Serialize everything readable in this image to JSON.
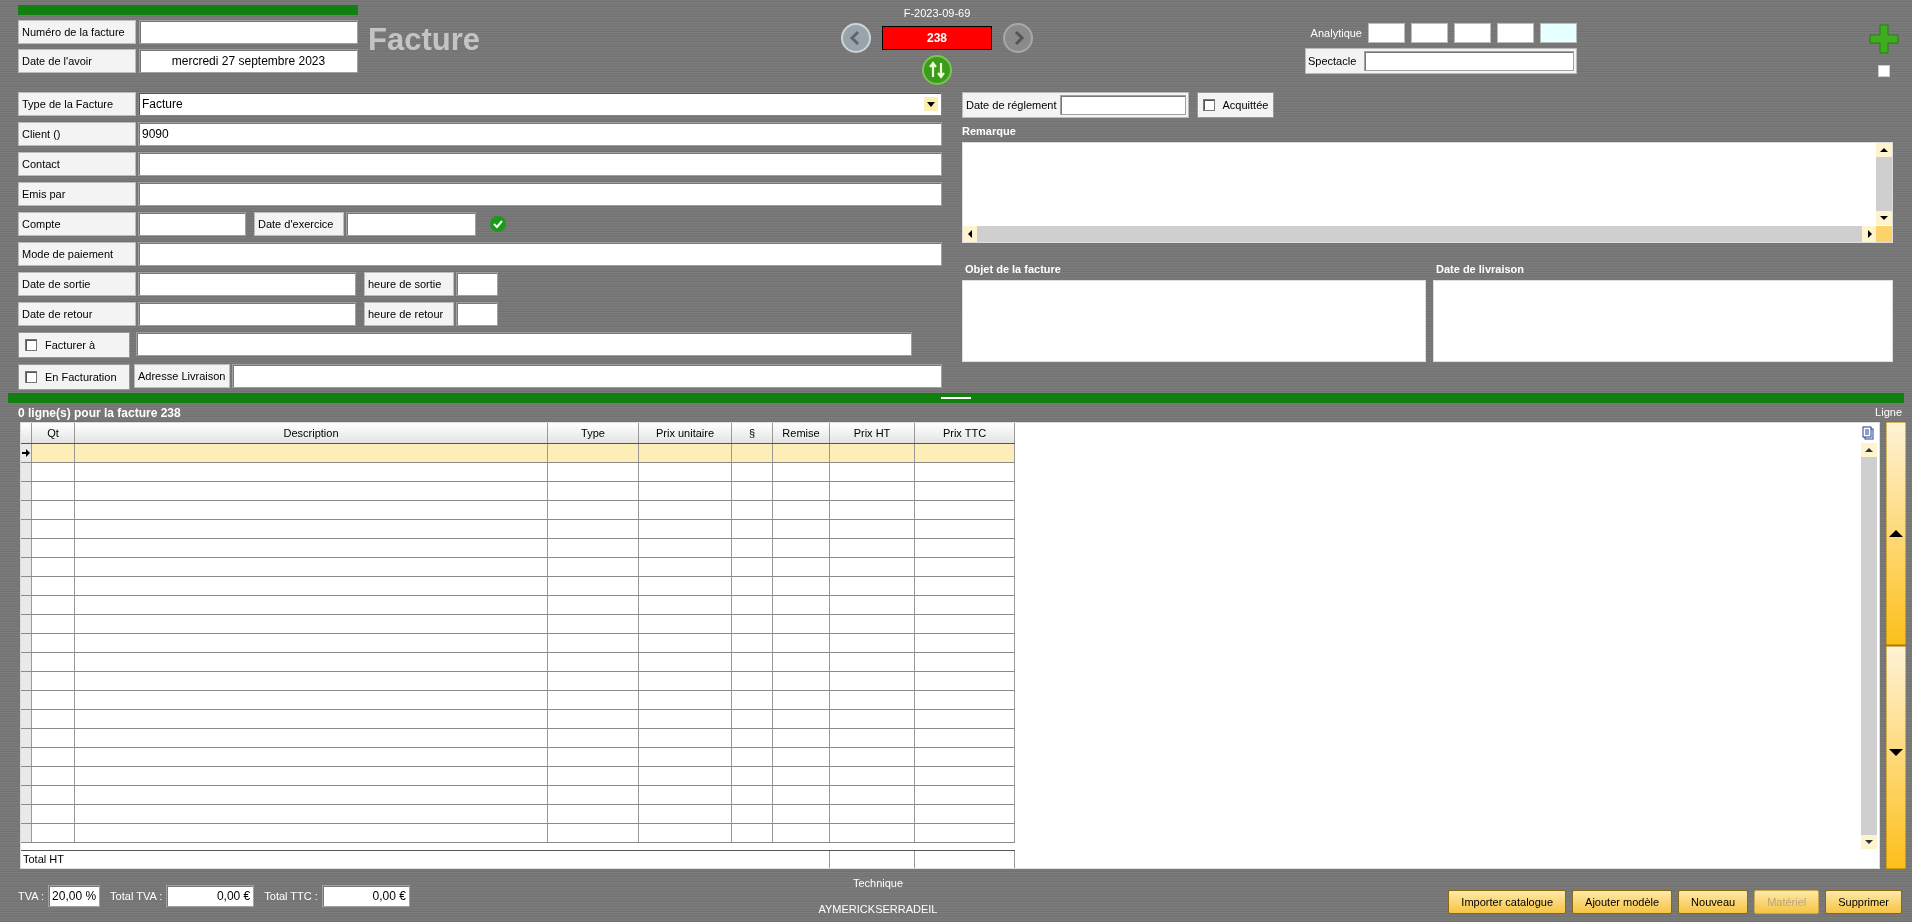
{
  "header": {
    "invoice_number": {
      "label": "Numéro de la facture"
    },
    "credit_date": {
      "label": "Date de l'avoir",
      "value": "mercredi 27 septembre 2023"
    },
    "title": "Facture"
  },
  "navigator": {
    "reference": "F-2023-09-69",
    "number": "238"
  },
  "analytique": {
    "label": "Analytique",
    "fields": [
      {
        "highlighted": false
      },
      {
        "highlighted": false
      },
      {
        "highlighted": false
      },
      {
        "highlighted": false
      },
      {
        "highlighted": true
      }
    ]
  },
  "spectacle": {
    "label": "Spectacle"
  },
  "corner_checkbox": {
    "checked": false
  },
  "form": {
    "type": {
      "label": "Type de la Facture",
      "value": "Facture"
    },
    "client": {
      "label": "Client ()",
      "value": "9090"
    },
    "contact": {
      "label": "Contact"
    },
    "emis_par": {
      "label": "Emis par"
    },
    "compte": {
      "label": "Compte"
    },
    "date_exercice": {
      "label": "Date d'exercice"
    },
    "mode_paiement": {
      "label": "Mode de paiement"
    },
    "date_sortie": {
      "label": "Date de sortie"
    },
    "heure_sortie": {
      "label": "heure de sortie"
    },
    "date_retour": {
      "label": "Date de retour"
    },
    "heure_retour": {
      "label": "heure de retour"
    },
    "facturer_a": {
      "label": "Facturer à",
      "checked": false
    },
    "en_facturation": {
      "label": "En Facturation",
      "checked": false
    },
    "adresse_livraison": {
      "label": "Adresse Livraison"
    }
  },
  "side": {
    "date_reglement": {
      "label": "Date de réglement"
    },
    "acquittee": {
      "label": "Acquittée",
      "checked": false
    },
    "remarque": {
      "label": "Remarque"
    },
    "objet": {
      "label": "Objet de la facture"
    },
    "date_livraison": {
      "label": "Date de livraison"
    }
  },
  "lines": {
    "summary": "0 ligne(s) pour la facture 238",
    "side_label": "Ligne",
    "columns": [
      "Qt",
      "Description",
      "Type",
      "Prix unitaire",
      "§",
      "Remise",
      "Prix HT",
      "Prix TTC"
    ],
    "rows": [
      {
        "selected": true
      },
      {
        "selected": false
      },
      {
        "selected": false
      },
      {
        "selected": false
      },
      {
        "selected": false
      },
      {
        "selected": false
      },
      {
        "selected": false
      },
      {
        "selected": false
      },
      {
        "selected": false
      },
      {
        "selected": false
      },
      {
        "selected": false
      },
      {
        "selected": false
      },
      {
        "selected": false
      },
      {
        "selected": false
      },
      {
        "selected": false
      },
      {
        "selected": false
      },
      {
        "selected": false
      },
      {
        "selected": false
      },
      {
        "selected": false
      },
      {
        "selected": false
      },
      {
        "selected": false
      }
    ],
    "total_label": "Total HT"
  },
  "footer": {
    "tva": {
      "label": "TVA :",
      "value": "20,00 %"
    },
    "total_tva": {
      "label": "Total TVA :",
      "value": "0,00 €"
    },
    "total_ttc": {
      "label": "Total TTC :",
      "value": "0,00 €"
    },
    "technique": "Technique",
    "user": "AYMERICKSERRADEIL",
    "buttons": [
      {
        "label": "Importer catalogue",
        "disabled": false
      },
      {
        "label": "Ajouter modèle",
        "disabled": false
      },
      {
        "label": "Nouveau",
        "disabled": false
      },
      {
        "label": "Matériel",
        "disabled": true
      },
      {
        "label": "Supprimer",
        "disabled": false
      }
    ]
  }
}
